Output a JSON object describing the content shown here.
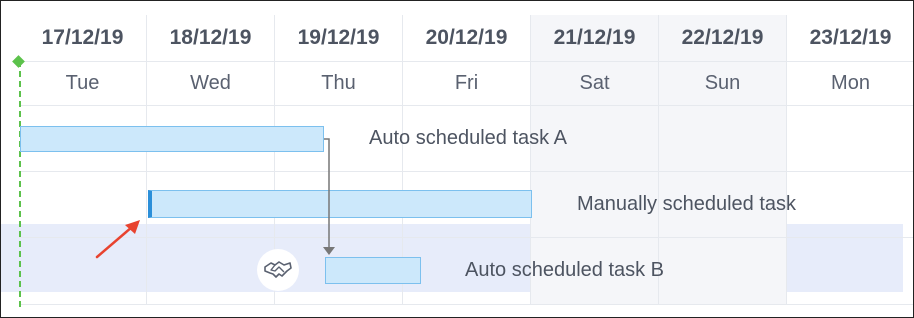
{
  "timeline": {
    "columns": [
      {
        "date": "17/12/19",
        "day": "Tue"
      },
      {
        "date": "18/12/19",
        "day": "Wed"
      },
      {
        "date": "19/12/19",
        "day": "Thu"
      },
      {
        "date": "20/12/19",
        "day": "Fri"
      },
      {
        "date": "21/12/19",
        "day": "Sat"
      },
      {
        "date": "22/12/19",
        "day": "Sun"
      },
      {
        "date": "23/12/19",
        "day": "Mon"
      }
    ]
  },
  "tasks": [
    {
      "label": "Auto scheduled task A"
    },
    {
      "label": "Manually scheduled task"
    },
    {
      "label": "Auto scheduled task B"
    }
  ],
  "colors": {
    "bar_fill": "#cce8fb",
    "bar_border": "#7cc0ee",
    "manual_edge": "#2b8fd9",
    "today_line": "#5cc24b",
    "annotation_arrow": "#e8432f",
    "selected_row": "#dfe6f8"
  },
  "icons": {
    "mode_toggle": "handshake-icon"
  }
}
